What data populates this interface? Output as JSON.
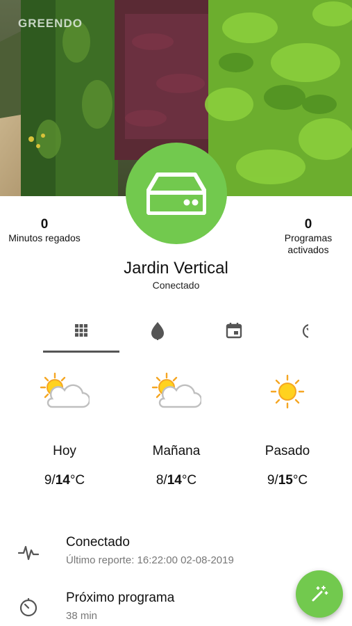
{
  "hero": {
    "brand": "GREENDO",
    "image": "vertical-garden-photo"
  },
  "device": {
    "icon": "hard-drive-icon",
    "name": "Jardin Vertical",
    "status": "Conectado",
    "accent": "#72c94e"
  },
  "stats": {
    "left": {
      "value": "0",
      "label": "Minutos regados"
    },
    "right": {
      "value": "0",
      "label_line1": "Programas",
      "label_line2": "activados"
    }
  },
  "tabs": [
    {
      "icon": "grid-icon",
      "selected": true
    },
    {
      "icon": "leaf-drop-icon",
      "selected": false
    },
    {
      "icon": "calendar-icon",
      "selected": false
    },
    {
      "icon": "timer-icon",
      "selected": false
    }
  ],
  "weather": [
    {
      "icon": "partly-cloudy-icon",
      "day": "Hoy",
      "min": "9/",
      "max": "14",
      "unit": "°C"
    },
    {
      "icon": "partly-cloudy-icon",
      "day": "Mañana",
      "min": "8/",
      "max": "14",
      "unit": "°C"
    },
    {
      "icon": "sunny-icon",
      "day": "Pasado",
      "min": "9/",
      "max": "15",
      "unit": "°C"
    }
  ],
  "list": {
    "connection": {
      "icon": "pulse-icon",
      "title": "Conectado",
      "subtitle": "Último reporte: 16:22:00 02-08-2019"
    },
    "next_program": {
      "icon": "timer-icon",
      "title": "Próximo programa",
      "subtitle": "38 min"
    }
  },
  "fab": {
    "icon": "magic-wand-icon"
  }
}
